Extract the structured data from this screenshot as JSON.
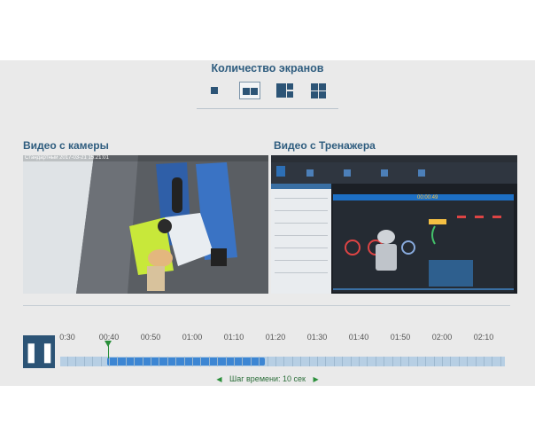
{
  "header": {
    "title": "Количество экранов"
  },
  "screen_count": {
    "options": [
      {
        "name": "screens-1",
        "active": false
      },
      {
        "name": "screens-2",
        "active": true
      },
      {
        "name": "screens-3",
        "active": false
      },
      {
        "name": "screens-4",
        "active": false
      }
    ]
  },
  "camera": {
    "label": "Видео с камеры",
    "timestamp": "Стандартный 2017-03-21 15:21:01"
  },
  "trainer": {
    "label": "Видео с Тренажера",
    "time": "00:00:49"
  },
  "timeline": {
    "ticks": [
      "0:30",
      "00:40",
      "00:50",
      "01:00",
      "01:10",
      "01:20",
      "01:30",
      "01:40",
      "01:50",
      "02:00",
      "02:10"
    ],
    "play_state": "pause",
    "step_label": "Шаг времени:",
    "step_value": "10 сек",
    "accent": "#2a8f3a",
    "fill_color": "#3d86d3"
  }
}
